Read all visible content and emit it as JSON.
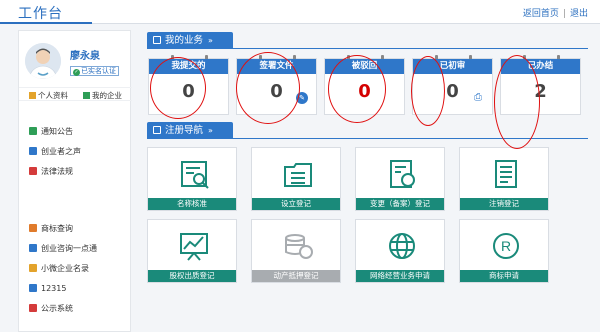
{
  "header": {
    "title": "工作台",
    "home_link": "返回首页",
    "logout_link": "退出"
  },
  "user": {
    "name": "廖永泉",
    "verified": "已实名认证"
  },
  "user_links": {
    "profile": "个人资料",
    "enterprise": "我的企业"
  },
  "sidebar_group1": [
    {
      "label": "通知公告",
      "color": "#2e9e57"
    },
    {
      "label": "创业者之声",
      "color": "#2f77c9"
    },
    {
      "label": "法律法规",
      "color": "#d43b3b"
    }
  ],
  "sidebar_group2": [
    {
      "label": "商标查询",
      "color": "#e07b2b"
    },
    {
      "label": "创业咨询一点通",
      "color": "#2f77c9"
    },
    {
      "label": "小微企业名录",
      "color": "#e3a32b"
    },
    {
      "label": "12315",
      "color": "#2f77c9"
    },
    {
      "label": "公示系统",
      "color": "#d43b3b"
    }
  ],
  "business": {
    "tab_label": "我的业务",
    "cards": [
      {
        "label": "我提交的",
        "value": "0",
        "red": false
      },
      {
        "label": "签署文件",
        "value": "0",
        "red": false
      },
      {
        "label": "被驳回",
        "value": "0",
        "red": true
      },
      {
        "label": "已初审",
        "value": "0",
        "red": false
      },
      {
        "label": "已办结",
        "value": "2",
        "red": false
      }
    ]
  },
  "registration": {
    "tab_label": "注册导航",
    "tiles": [
      {
        "label": "名称核准",
        "icon": "document-search-icon",
        "disabled": false
      },
      {
        "label": "设立登记",
        "icon": "folder-list-icon",
        "disabled": false
      },
      {
        "label": "变更（备案）登记",
        "icon": "document-refresh-icon",
        "disabled": false
      },
      {
        "label": "注销登记",
        "icon": "document-lines-icon",
        "disabled": false
      },
      {
        "label": "股权出质登记",
        "icon": "chart-board-icon",
        "disabled": false
      },
      {
        "label": "动产抵押登记",
        "icon": "coins-icon",
        "disabled": true
      },
      {
        "label": "网络经营业务申请",
        "icon": "globe-icon",
        "disabled": false
      },
      {
        "label": "商标申请",
        "icon": "registered-mark-icon",
        "disabled": false
      }
    ]
  },
  "colors": {
    "primary": "#2f77c9",
    "tile_label": "#1a8a7a",
    "alert": "#d40000",
    "annotation": "#e01010"
  }
}
